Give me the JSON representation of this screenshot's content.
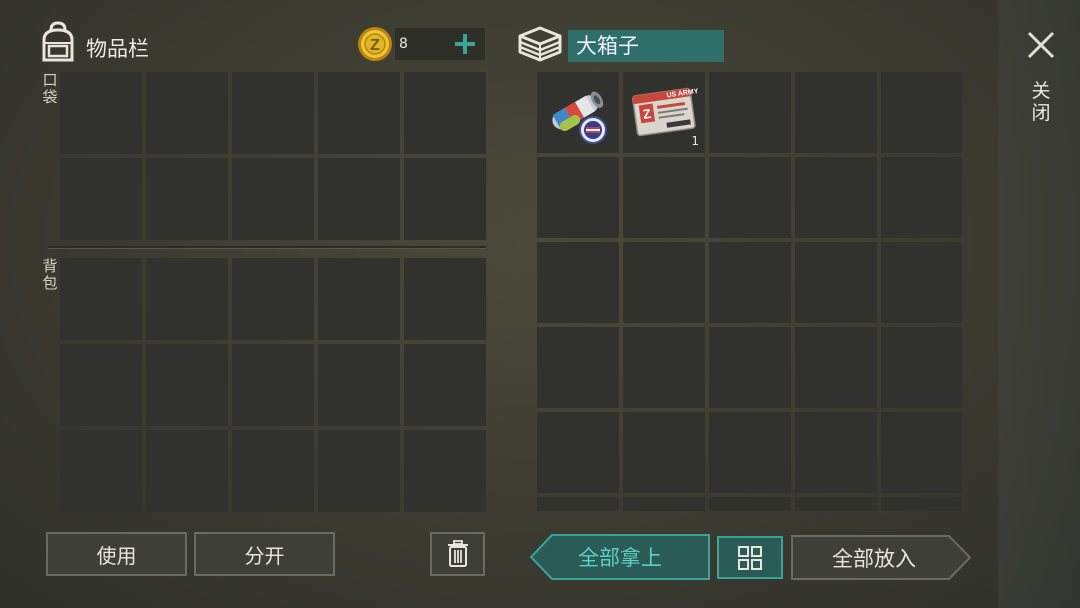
{
  "inventory": {
    "title": "物品栏",
    "coins": "8",
    "pocket_label": "口袋",
    "backpack_label": "背包"
  },
  "container": {
    "name": "大箱子",
    "items": [
      {
        "slot": 0,
        "name": "posters-roll",
        "qty": ""
      },
      {
        "slot": 1,
        "name": "us-army-id-card",
        "qty": "1"
      }
    ]
  },
  "close": {
    "label": "关闭"
  },
  "buttons": {
    "use": "使用",
    "split": "分开",
    "take_all": "全部拿上",
    "put_all": "全部放入"
  },
  "colors": {
    "accent_teal": "#2f6f6a",
    "accent_teal_bright": "#3aa39a",
    "coin_gold": "#e0b52a"
  },
  "icons": [
    "backpack-icon",
    "coin-icon",
    "plus-icon",
    "crate-icon",
    "close-icon",
    "trash-icon",
    "grid-sort-icon"
  ]
}
